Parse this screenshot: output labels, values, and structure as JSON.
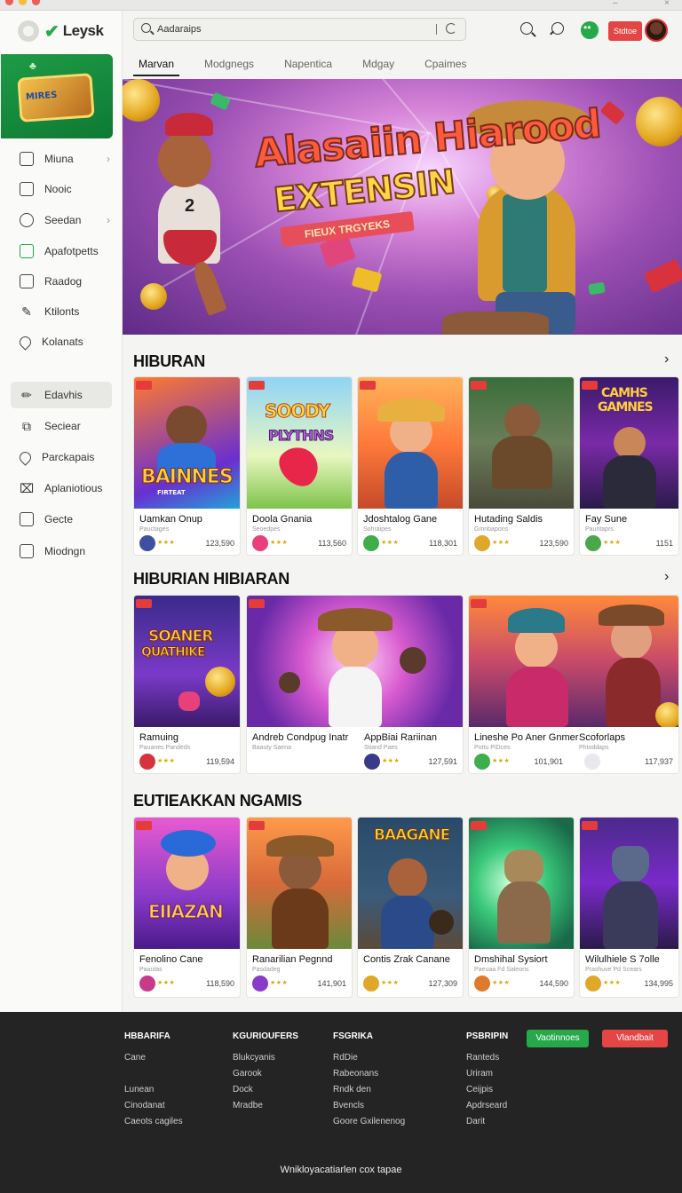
{
  "window": {
    "controls": [
      "–",
      "×"
    ]
  },
  "brand": {
    "name": "Leysk"
  },
  "sidebar": {
    "promo_title": "MIRES",
    "items": [
      {
        "label": "Miuna",
        "icon": "smiley-square-icon",
        "chevron": true,
        "active": false
      },
      {
        "label": "Nooic",
        "icon": "document-icon",
        "chevron": false,
        "active": false
      },
      {
        "label": "Seedan",
        "icon": "people-icon",
        "chevron": true,
        "active": false
      },
      {
        "label": "Apafotpetts",
        "icon": "apps-green-icon",
        "chevron": false,
        "active": false
      },
      {
        "label": "Raadog",
        "icon": "chart-icon",
        "chevron": false,
        "active": false
      },
      {
        "label": "Ktilonts",
        "icon": "pen-icon",
        "chevron": false,
        "active": false
      },
      {
        "label": "Kolanats",
        "icon": "location-icon",
        "chevron": false,
        "active": false
      },
      {
        "label": "Edavhis",
        "icon": "edit-icon",
        "chevron": false,
        "active": true
      },
      {
        "label": "Seciear",
        "icon": "bookmark-icon",
        "chevron": false,
        "active": false
      },
      {
        "label": "Parckapais",
        "icon": "tag-icon",
        "chevron": false,
        "active": false
      },
      {
        "label": "Aplaniotious",
        "icon": "grid-x-icon",
        "chevron": false,
        "active": false
      },
      {
        "label": "Gecte",
        "icon": "calendar-icon",
        "chevron": false,
        "active": false
      },
      {
        "label": "Miodngn",
        "icon": "archive-icon",
        "chevron": false,
        "active": false
      }
    ]
  },
  "header": {
    "search_value": "Aadaraips",
    "store_label": "Stdtoe",
    "tabs": [
      "Marvan",
      "Modgnegs",
      "Napentica",
      "Mdgay",
      "Cpaimes"
    ]
  },
  "hero": {
    "title_line1": "Alasaiin Hiarood",
    "title_line2": "EXTENSIN",
    "ribbon": "FIEUX TRGYEKS",
    "jersey_number": "2"
  },
  "sections": [
    {
      "title": "HIBURAN",
      "cards": [
        {
          "name": "Uamkan Onup",
          "sub": "Pauctages",
          "count": "123,590",
          "thumb_text": "BAINNES",
          "thumb_subtext": "FIRTEAT"
        },
        {
          "name": "Doola Gnania",
          "sub": "Seoedpes",
          "count": "113,560",
          "thumb_text": "SOODY",
          "thumb_subtext": "PLYTHNS"
        },
        {
          "name": "Jdoshtalog Gane",
          "sub": "Sohraipes",
          "count": "118,301",
          "thumb_text": "",
          "thumb_subtext": ""
        },
        {
          "name": "Hutading Saldis",
          "sub": "Gmnbapons",
          "count": "123,590",
          "thumb_text": "",
          "thumb_subtext": ""
        },
        {
          "name": "Fay Sune",
          "sub": "Pauntaprs",
          "count": "1151",
          "thumb_text": "CAMHS",
          "thumb_subtext": "GAMNES"
        }
      ]
    },
    {
      "title": "HIBURIAN HIBIARAN",
      "cards": [
        {
          "name": "Ramuing",
          "sub": "Pauanes Pandeds",
          "count": "119,594",
          "thumb_text": "SOANER",
          "thumb_subtext": "QUATHIKE"
        },
        {
          "name": "Andreb Condpug Inatr",
          "sub": "Baauty Saena",
          "count": "",
          "thumb_text": "",
          "thumb_subtext": ""
        },
        {
          "name": "AppBiai Rariinan",
          "sub": "Stiand Paes",
          "count": "127,591",
          "thumb_text": "",
          "thumb_subtext": ""
        },
        {
          "name": "Lineshe Po Aner Gnmer",
          "sub": "Pottu PiDces",
          "count": "101,901",
          "thumb_text": "",
          "thumb_subtext": ""
        },
        {
          "name": "Scoforlaps",
          "sub": "Phtoddaps",
          "count": "117,937",
          "thumb_text": "",
          "thumb_subtext": ""
        }
      ]
    },
    {
      "title": "EUTIEAKKAN NGAMIS",
      "cards": [
        {
          "name": "Fenolino Cane",
          "sub": "Paautas",
          "count": "118,590",
          "thumb_text": "EIIAZAN",
          "thumb_subtext": ""
        },
        {
          "name": "Ranarilian Pegnnd",
          "sub": "Pasdadeg",
          "count": "141,901",
          "thumb_text": "",
          "thumb_subtext": ""
        },
        {
          "name": "Contis Zrak Canane",
          "sub": "",
          "count": "127,309",
          "thumb_text": "BAAGANE",
          "thumb_subtext": ""
        },
        {
          "name": "Dmshihal Sysiort",
          "sub": "Paeuaa Fd Saleons",
          "count": "144,590",
          "thumb_text": "",
          "thumb_subtext": ""
        },
        {
          "name": "Wilulhiele S 7olle",
          "sub": "Prashuve Pd Scears",
          "count": "134,995",
          "thumb_text": "",
          "thumb_subtext": ""
        }
      ]
    }
  ],
  "footer": {
    "columns": [
      {
        "heading": "HBBARIFA",
        "links": [
          "Cane",
          "",
          "Lunean",
          "Cinodanat",
          "Caeots cagiles"
        ]
      },
      {
        "heading": "KGURIOUFERS",
        "links": [
          "Blukcyanis",
          "Garook",
          "Dock",
          "Mradbe"
        ]
      },
      {
        "heading": "FSGRIKA",
        "links": [
          "RdDie",
          "Rabeonans",
          "Rndk den",
          "Bvencls",
          "Goore Gxilenenog"
        ]
      },
      {
        "heading": "PSBRIPIN",
        "links": [
          "Ranteds",
          "Uriram",
          "Ceijpis",
          "Apdrseard",
          "Darit"
        ]
      }
    ],
    "btn_green": "Vaotinnoes",
    "btn_red": "Vlandbait",
    "bottom_text": "Wnikloyacatiarlen cox tapae"
  },
  "colors": {
    "accent_green": "#27a84a",
    "accent_red": "#e54545",
    "footer_bg": "#242424"
  }
}
